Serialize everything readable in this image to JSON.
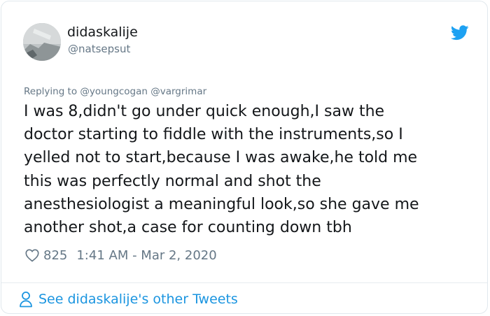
{
  "author": {
    "display_name": "didaskalije",
    "handle": "@natsepsut",
    "avatar_icon": "avatar-image"
  },
  "brand": {
    "icon": "twitter-bird-icon",
    "color": "#1da1f2"
  },
  "reply": {
    "prefix": "Replying to",
    "mentions": [
      "@youngcogan",
      "@vargrimar"
    ]
  },
  "tweet": {
    "lines": [
      "I was 8,didn't go under quick enough,I saw the",
      "doctor starting to fiddle with the instruments,so I",
      "yelled not to start,because I was awake,he told me",
      "this was perfectly normal and shot the",
      "anesthesiologist a meaningful look,so she gave me",
      "another shot,a case for counting down tbh"
    ]
  },
  "meta": {
    "like_icon": "heart-icon",
    "like_count": "825",
    "timestamp": "1:41 AM - Mar 2, 2020"
  },
  "footer": {
    "icon": "person-icon",
    "link_text": "See didaskalije's other Tweets",
    "link_color": "#1b95e0"
  }
}
